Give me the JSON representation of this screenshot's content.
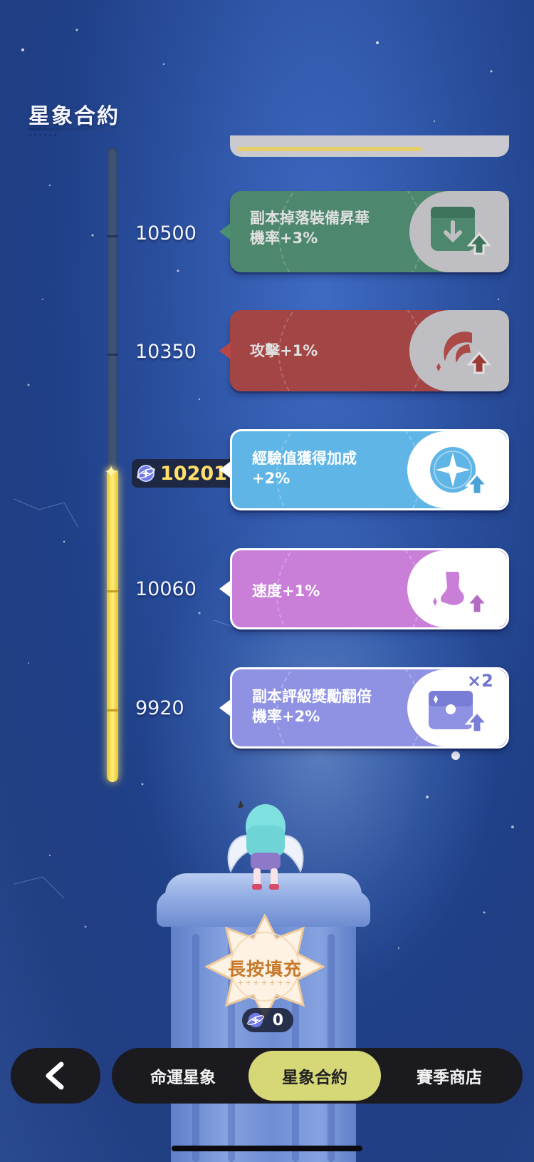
{
  "header": {
    "title": "星象合約"
  },
  "progress": {
    "current_value": "10201",
    "milestones": [
      "10500",
      "10350",
      "10060",
      "9920"
    ]
  },
  "rewards": [
    {
      "threshold": "10500",
      "label": "副本掉落裝備昇華\n機率+3%",
      "color": "#4f9c7a",
      "icon": "box-download-icon",
      "state": "claimed"
    },
    {
      "threshold": "10350",
      "label": "攻擊+1%",
      "color": "#c84a4a",
      "icon": "attack-slash-icon",
      "state": "claimed"
    },
    {
      "threshold": "10201",
      "label": "經驗值獲得加成\n+2%",
      "color": "#5fb5e5",
      "icon": "exp-star-icon",
      "state": "active"
    },
    {
      "threshold": "10060",
      "label": "速度+1%",
      "color": "#c97fd8",
      "icon": "speed-boot-icon",
      "state": "active"
    },
    {
      "threshold": "9920",
      "label": "副本評級獎勵翻倍\n機率+2%",
      "color": "#8f92e3",
      "icon": "treasure-chest-icon",
      "state": "active",
      "badge": "×2"
    }
  ],
  "fill_button": {
    "label": "長按填充",
    "cost": "0"
  },
  "nav": {
    "tabs": [
      "命運星象",
      "星象合約",
      "賽季商店"
    ],
    "active_tab": "星象合約"
  },
  "colors": {
    "track_fill": "#f5de5a",
    "active_tab": "#d6d878",
    "nav_bg": "#1b1b1f"
  }
}
